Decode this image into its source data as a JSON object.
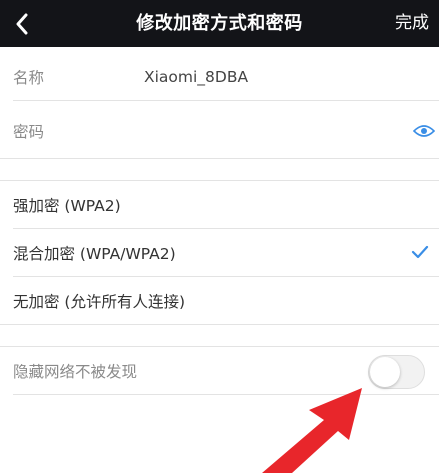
{
  "header": {
    "title": "修改加密方式和密码",
    "done_label": "完成",
    "back_icon": "chevron-left-icon"
  },
  "network": {
    "name_label": "名称",
    "name_value": "Xiaomi_8DBA",
    "password_label": "密码",
    "password_icon": "eye-icon"
  },
  "encryption": {
    "options": [
      {
        "label": "强加密 (WPA2)",
        "selected": false
      },
      {
        "label": "混合加密 (WPA/WPA2)",
        "selected": true
      },
      {
        "label": "无加密 (允许所有人连接)",
        "selected": false
      }
    ]
  },
  "hidden_network": {
    "label": "隐藏网络不被发现",
    "enabled": false
  },
  "colors": {
    "header_bg": "#131418",
    "accent": "#3a8ee6",
    "annotation_arrow": "#e8262b"
  }
}
